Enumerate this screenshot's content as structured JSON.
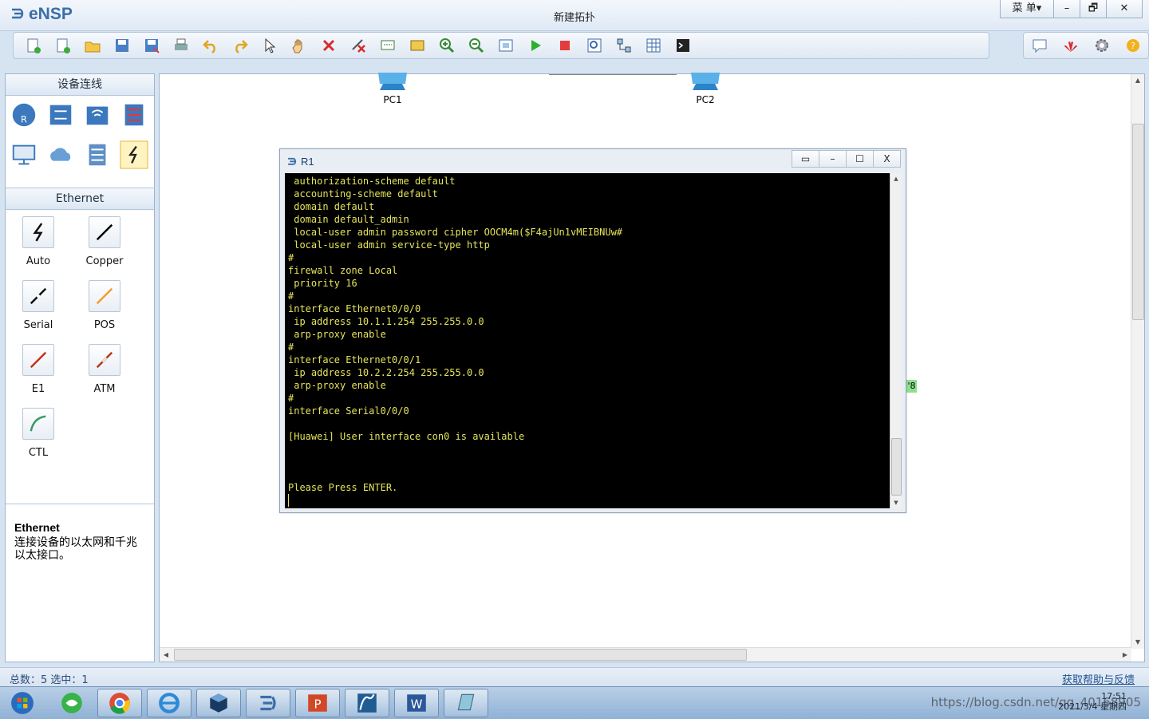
{
  "app": {
    "logo_text": "eNSP",
    "window_title": "新建拓扑",
    "window_controls": {
      "menu": "菜 单▾",
      "minimize": "–",
      "restore": "🗗",
      "close": "✕"
    }
  },
  "toolbar": {
    "icons": [
      "new-topology-icon",
      "new-example-icon",
      "open-icon",
      "save-icon",
      "save-as-icon",
      "print-icon",
      "undo-icon",
      "redo-icon",
      "select-icon",
      "pan-hand-icon",
      "delete-icon",
      "delete-link-icon",
      "text-note-icon",
      "rectangle-icon",
      "zoom-in-icon",
      "zoom-out-icon",
      "fit-view-icon",
      "start-device-icon",
      "stop-device-icon",
      "capture-icon",
      "topology-icon",
      "grid-icon",
      "console-icon"
    ],
    "right_icons": [
      "chat-icon",
      "huawei-icon",
      "settings-icon",
      "help-icon"
    ]
  },
  "left_panel": {
    "device_header": "设备连线",
    "devices": [
      "router-icon",
      "switch-icon",
      "wireless-icon",
      "firewall-icon",
      "pc-icon",
      "cloud-icon",
      "server-icon",
      "cable-icon"
    ],
    "cable_header": "Ethernet",
    "cables": [
      {
        "label": "Auto",
        "color": "#000000"
      },
      {
        "label": "Copper",
        "color": "#000000"
      },
      {
        "label": "Serial",
        "color": "#000000"
      },
      {
        "label": "POS",
        "color": "#f39c2a"
      },
      {
        "label": "E1",
        "color": "#c0341d"
      },
      {
        "label": "ATM",
        "color": "#b03c1e"
      },
      {
        "label": "CTL",
        "color": "#3a9a6a"
      }
    ],
    "description": {
      "title": "Ethernet",
      "text": "连接设备的以太网和千兆以太接口。"
    }
  },
  "canvas": {
    "nodes": [
      {
        "label": "PC1"
      },
      {
        "label": "PC2"
      }
    ],
    "port_tag": "'8"
  },
  "console": {
    "title": "R1",
    "controls": {
      "restore": "▭",
      "minimize": "–",
      "maximize": "☐",
      "close": "X"
    },
    "lines": [
      " authorization-scheme default",
      " accounting-scheme default",
      " domain default",
      " domain default_admin",
      " local-user admin password cipher OOCM4m($F4ajUn1vMEIBNUw#",
      " local-user admin service-type http",
      "#",
      "firewall zone Local",
      " priority 16",
      "#",
      "interface Ethernet0/0/0",
      " ip address 10.1.1.254 255.255.0.0",
      " arp-proxy enable",
      "#",
      "interface Ethernet0/0/1",
      " ip address 10.2.2.254 255.255.0.0",
      " arp-proxy enable",
      "#",
      "interface Serial0/0/0",
      "",
      "[Huawei] User interface con0 is available",
      "",
      "",
      "",
      "Please Press ENTER."
    ]
  },
  "status_bar": {
    "left": "总数：5  选中：1",
    "right": "获取帮助与反馈"
  },
  "taskbar": {
    "apps": [
      "windows-start-icon",
      "360-browser-icon",
      "chrome-icon",
      "ie-icon",
      "virtualbox-icon",
      "ensp-icon",
      "powerpoint-icon",
      "wireshark-icon",
      "word-icon",
      "notebook-icon"
    ],
    "clock_time": "17:51",
    "clock_date": "2021/3/4 星期四",
    "watermark": "https://blog.csdn.net/qq_40168905"
  },
  "colors": {
    "accent": "#3b6ea8",
    "console_text": "#e6e45a",
    "console_bg": "#000000",
    "port_tag_bg": "#8ee08e"
  }
}
